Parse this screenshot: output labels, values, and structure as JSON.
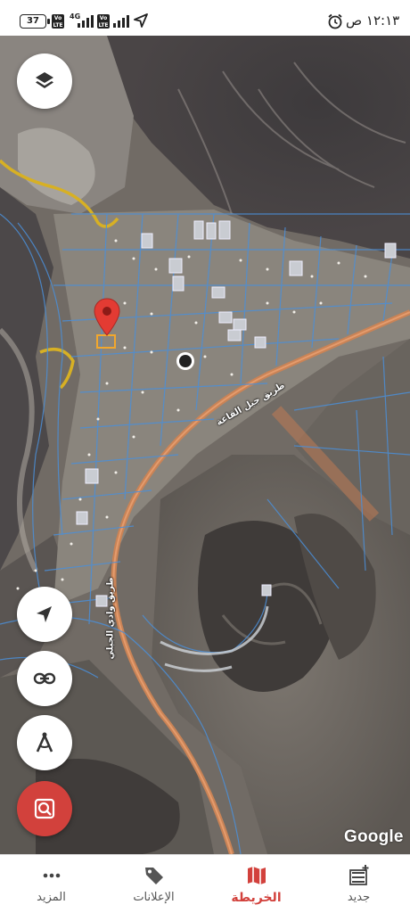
{
  "status_bar": {
    "battery": "37",
    "network": "4G",
    "volte_1": "Vo LTE",
    "volte_2": "Vo LTE",
    "time": "١٢:١٣ ص"
  },
  "map": {
    "attribution": "Google",
    "road_labels": [
      "طريق جبل القاعة",
      "طريق وادي الجبلي"
    ],
    "buttons": [
      "layers-icon",
      "my-location-icon",
      "link-icon",
      "compass-measure-icon",
      "search-parcel-icon"
    ],
    "accent_color": "#d2413c"
  },
  "bottom_nav": {
    "items": [
      {
        "label": "المزيد",
        "icon": "more-dots-icon",
        "active": false
      },
      {
        "label": "الإعلانات",
        "icon": "tag-icon",
        "active": false
      },
      {
        "label": "الخريطة",
        "icon": "map-icon",
        "active": true
      },
      {
        "label": "جديد",
        "icon": "new-list-icon",
        "active": false
      }
    ]
  }
}
